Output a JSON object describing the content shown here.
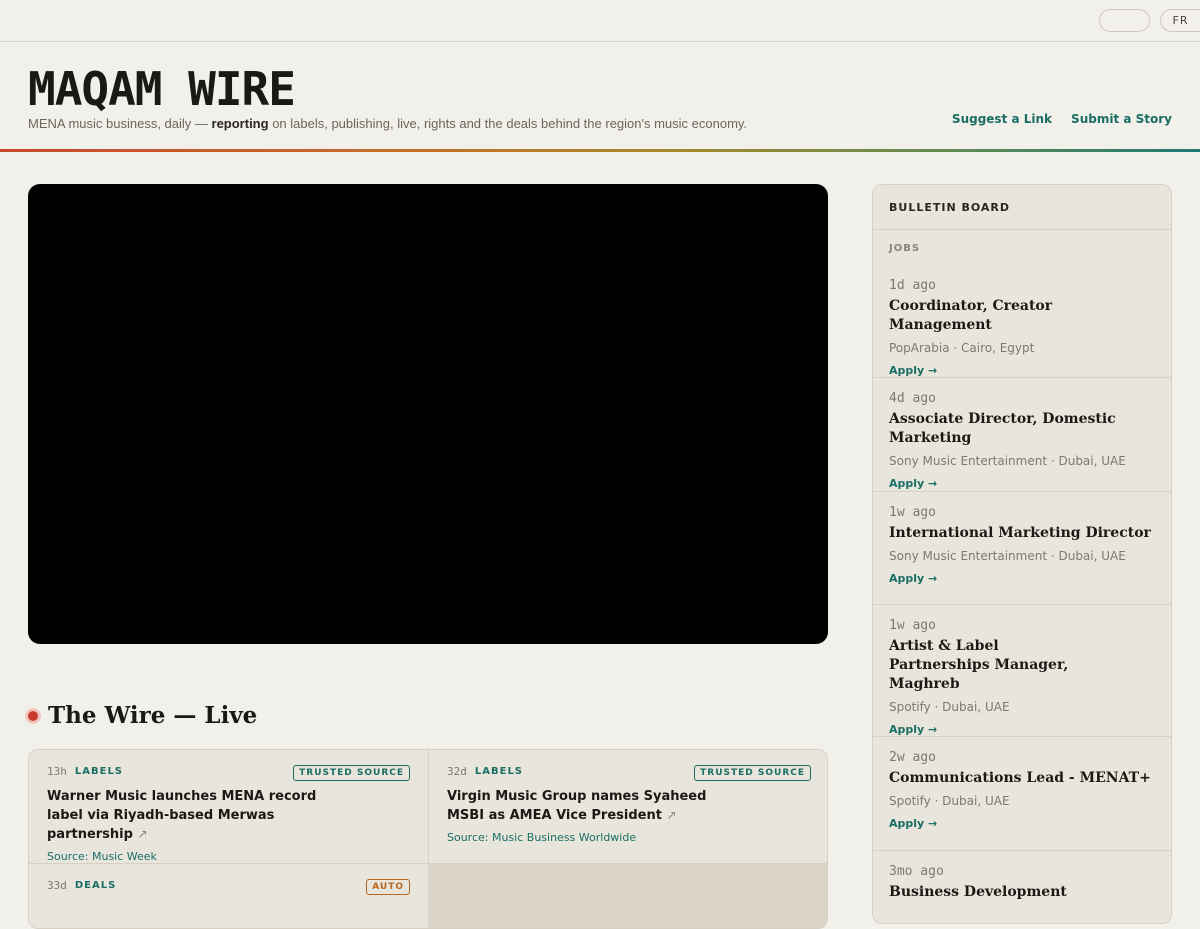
{
  "topbar": {
    "lang_label": "FR"
  },
  "masthead": {
    "brand": "MAQAM WIRE",
    "tagline_pre": "MENA music business, daily — ",
    "tagline_bold": "reporting",
    "tagline_post": " on labels, publishing, live, rights and the deals behind the region's music economy.",
    "links": {
      "suggest": "Suggest a Link",
      "submit": "Submit a Story"
    }
  },
  "wire": {
    "title": "The Wire — Live",
    "cards": [
      {
        "age": "13h",
        "category": "LABELS",
        "badge": "TRUSTED SOURCE",
        "title": "Warner Music launches MENA record label via Riyadh-based Merwas partnership",
        "arrow": "↗",
        "source": "Source: Music Week"
      },
      {
        "age": "32d",
        "category": "LABELS",
        "badge": "TRUSTED SOURCE",
        "title": "Virgin Music Group names Syaheed MSBI as AMEA Vice President",
        "arrow": "↗",
        "source": "Source: Music Business Worldwide"
      },
      {
        "age": "33d",
        "category": "DEALS",
        "badge": "AUTO"
      }
    ]
  },
  "sidebar": {
    "title": "BULLETIN BOARD",
    "section": "JOBS",
    "apply_label": "Apply →",
    "jobs": [
      {
        "age": "1d ago",
        "title": "Coordinator, Creator Management",
        "company": "PopArabia · Cairo, Egypt"
      },
      {
        "age": "4d ago",
        "title": "Associate Director, Domestic Marketing",
        "company": "Sony Music Entertainment · Dubai, UAE"
      },
      {
        "age": "1w ago",
        "title": "International Marketing Director",
        "company": "Sony Music Entertainment · Dubai, UAE"
      },
      {
        "age": "1w ago",
        "title": "Artist & Label Partnerships Manager, Maghreb",
        "company": "Spotify · Dubai, UAE"
      },
      {
        "age": "2w ago",
        "title": "Communications Lead - MENAT+",
        "company": "Spotify · Dubai, UAE"
      },
      {
        "age": "3mo ago",
        "title": "Business Development",
        "company": ""
      }
    ]
  }
}
